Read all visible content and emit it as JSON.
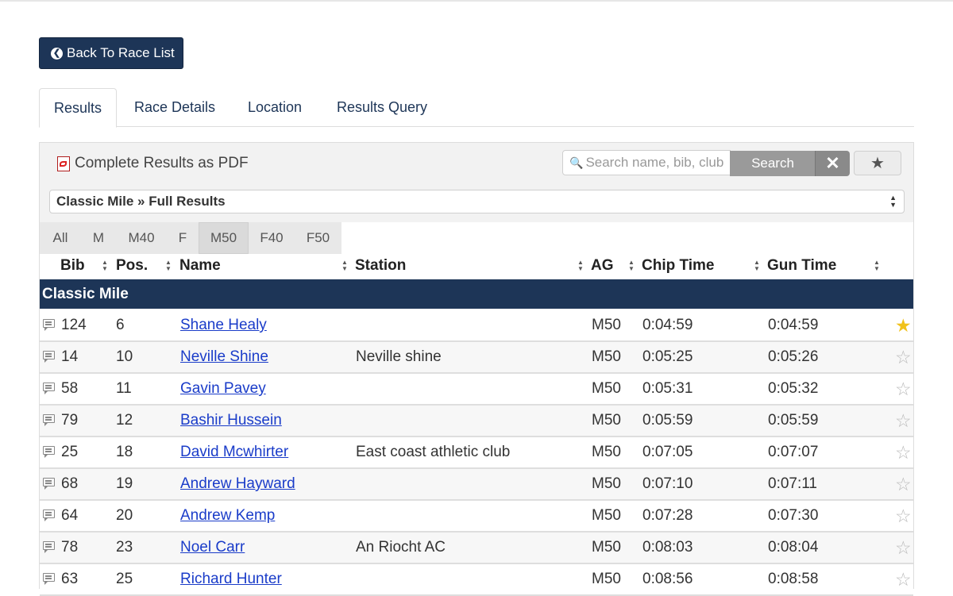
{
  "back_button": {
    "label": "Back To Race List",
    "icon": "arrow-circle-left-icon"
  },
  "tabs": [
    {
      "label": "Results",
      "active": true
    },
    {
      "label": "Race Details",
      "active": false
    },
    {
      "label": "Location",
      "active": false
    },
    {
      "label": "Results Query",
      "active": false
    }
  ],
  "toolbar": {
    "pdf_label": "Complete Results as PDF",
    "search_placeholder": "Search name, bib, club",
    "search_label": "Search",
    "clear_icon": "close-icon",
    "favorites_icon": "star-icon"
  },
  "race_select": {
    "value": "Classic Mile » Full Results"
  },
  "filters": [
    {
      "label": "All",
      "active": false
    },
    {
      "label": "M",
      "active": false
    },
    {
      "label": "M40",
      "active": false
    },
    {
      "label": "F",
      "active": false
    },
    {
      "label": "M50",
      "active": true
    },
    {
      "label": "F40",
      "active": false
    },
    {
      "label": "F50",
      "active": false
    }
  ],
  "columns": [
    "Bib",
    "Pos.",
    "Name",
    "Station",
    "AG",
    "Chip Time",
    "Gun Time"
  ],
  "section_title": "Classic Mile",
  "rows": [
    {
      "bib": "124",
      "pos": "6",
      "name": "Shane Healy",
      "station": "",
      "ag": "M50",
      "chip": "0:04:59",
      "gun": "0:04:59",
      "starred": true
    },
    {
      "bib": "14",
      "pos": "10",
      "name": "Neville Shine",
      "station": "Neville shine",
      "ag": "M50",
      "chip": "0:05:25",
      "gun": "0:05:26",
      "starred": false
    },
    {
      "bib": "58",
      "pos": "11",
      "name": "Gavin Pavey",
      "station": "",
      "ag": "M50",
      "chip": "0:05:31",
      "gun": "0:05:32",
      "starred": false
    },
    {
      "bib": "79",
      "pos": "12",
      "name": "Bashir Hussein",
      "station": "",
      "ag": "M50",
      "chip": "0:05:59",
      "gun": "0:05:59",
      "starred": false
    },
    {
      "bib": "25",
      "pos": "18",
      "name": "David Mcwhirter",
      "station": "East coast athletic club",
      "ag": "M50",
      "chip": "0:07:05",
      "gun": "0:07:07",
      "starred": false
    },
    {
      "bib": "68",
      "pos": "19",
      "name": "Andrew Hayward",
      "station": "",
      "ag": "M50",
      "chip": "0:07:10",
      "gun": "0:07:11",
      "starred": false
    },
    {
      "bib": "64",
      "pos": "20",
      "name": "Andrew Kemp",
      "station": "",
      "ag": "M50",
      "chip": "0:07:28",
      "gun": "0:07:30",
      "starred": false
    },
    {
      "bib": "78",
      "pos": "23",
      "name": "Noel Carr",
      "station": "An Riocht AC",
      "ag": "M50",
      "chip": "0:08:03",
      "gun": "0:08:04",
      "starred": false
    },
    {
      "bib": "63",
      "pos": "25",
      "name": "Richard Hunter",
      "station": "",
      "ag": "M50",
      "chip": "0:08:56",
      "gun": "0:08:58",
      "starred": false
    }
  ]
}
